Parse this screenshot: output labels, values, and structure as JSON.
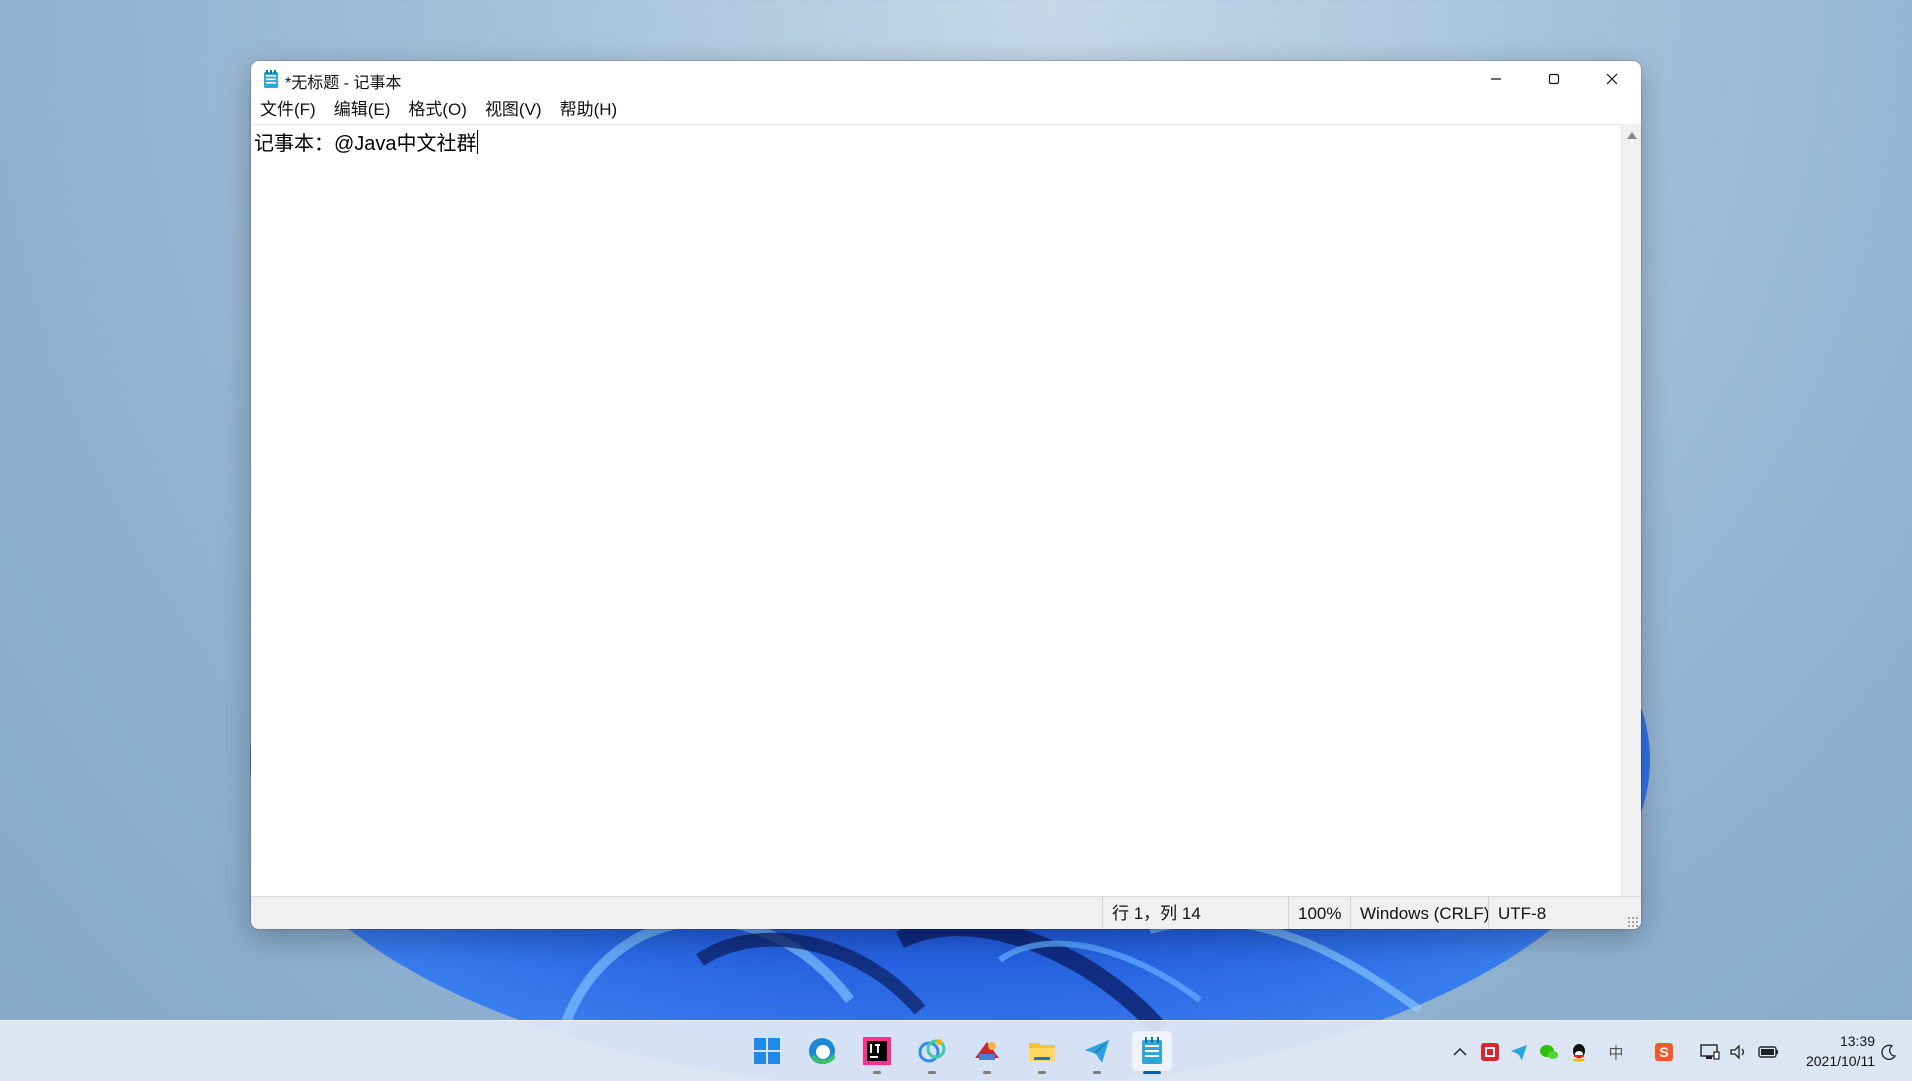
{
  "window": {
    "title": "*无标题 - 记事本",
    "menus": [
      "文件(F)",
      "编辑(E)",
      "格式(O)",
      "视图(V)",
      "帮助(H)"
    ],
    "content": "记事本：@Java中文社群",
    "buttons": {
      "minimize_icon": "minimize-icon",
      "maximize_icon": "maximize-icon",
      "close_icon": "close-icon"
    }
  },
  "statusbar": {
    "position": "行 1，列 14",
    "zoom": "100%",
    "line_ending": "Windows (CRLF)",
    "encoding": "UTF-8"
  },
  "taskbar": {
    "apps": [
      "start-icon",
      "edge-icon",
      "intellij-idea-icon",
      "browser-icon",
      "paint-icon",
      "file-explorer-icon",
      "telegram-icon",
      "notepad-icon"
    ],
    "tray": [
      "chevron-up-icon",
      "app-tray-icon",
      "telegram-tray-icon",
      "wechat-icon",
      "qq-icon",
      "input-mode-icon",
      "sogou-icon",
      "network-icon",
      "volume-icon",
      "battery-icon"
    ],
    "tray_text": {
      "input_mode": "中",
      "sogou": "S"
    },
    "clock": {
      "time": "13:39",
      "date": "2021/10/11"
    }
  },
  "colors": {
    "accent": "#005fb8",
    "window_bg": "#ffffff",
    "status_bg": "#f0f0f0"
  }
}
